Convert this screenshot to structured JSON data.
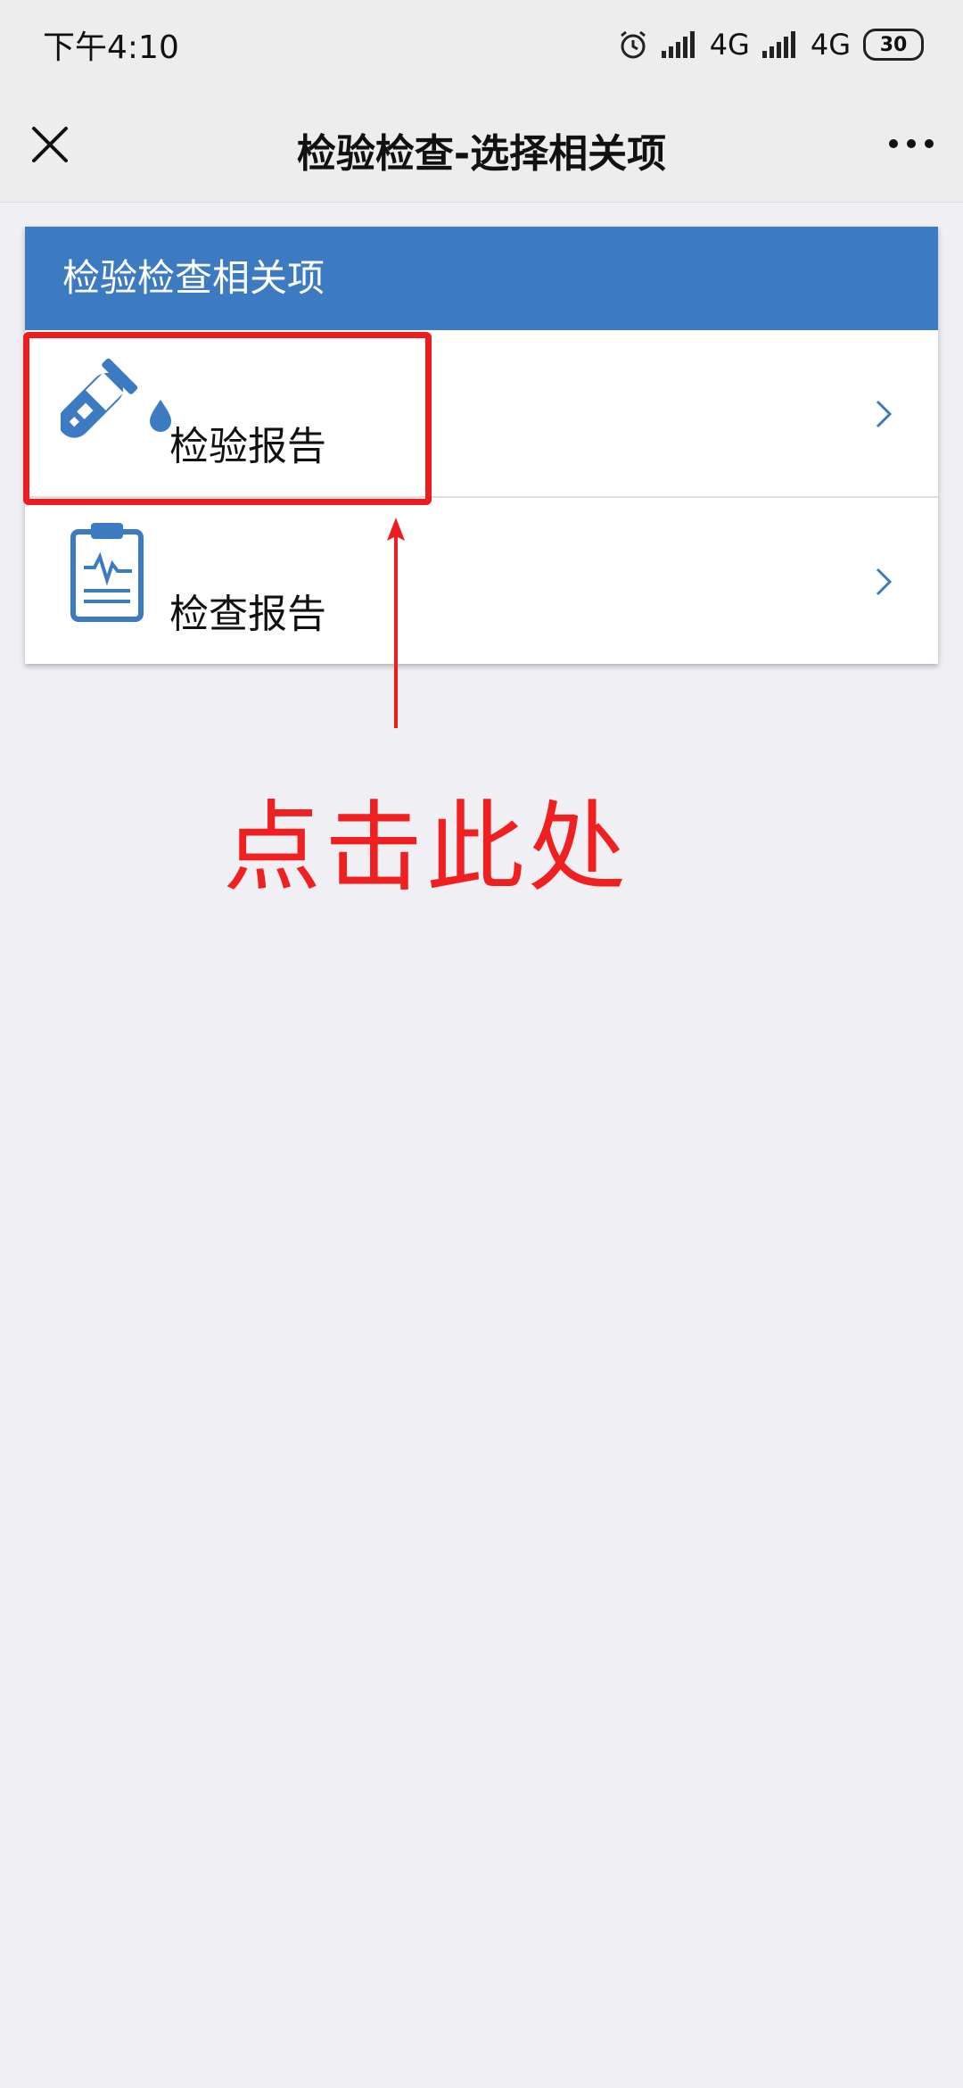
{
  "status_bar": {
    "time": "下午4:10",
    "network_1": "4G",
    "network_2": "4G",
    "battery": "30",
    "icons": [
      "alarm-icon",
      "signal-icon",
      "signal-icon"
    ]
  },
  "nav": {
    "title": "检验检查-选择相关项",
    "close_icon": "close-icon",
    "more_icon": "more-icon"
  },
  "panel": {
    "header": "检验检查相关项",
    "items": [
      {
        "label": "检验报告",
        "icon": "test-tube-icon"
      },
      {
        "label": "检查报告",
        "icon": "clipboard-report-icon"
      }
    ]
  },
  "annotation": {
    "text": "点击此处"
  },
  "colors": {
    "accent": "#3c7bc2",
    "annotation": "#ee1c1c",
    "background": "#efeff4"
  }
}
